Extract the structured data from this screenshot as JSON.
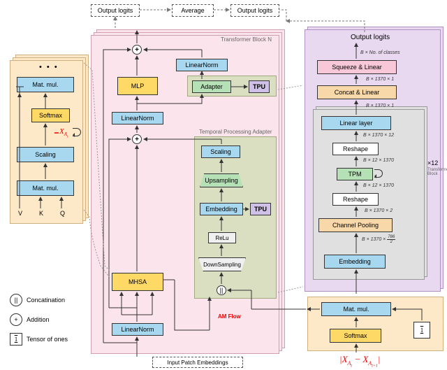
{
  "top": {
    "output_logits_1": "Output logits",
    "output_logits_2": "Output logits",
    "average": "Average"
  },
  "left_detail": {
    "matmul_top": "Mat. mul.",
    "softmax": "Softmax",
    "scaling": "Scaling",
    "matmul_bottom": "Mat. mul.",
    "x_label": "X",
    "x_sub": "A",
    "x_subsub": "t",
    "v": "V",
    "k": "K",
    "q": "Q",
    "dots": "• • •"
  },
  "legend": {
    "concat": "Concatination",
    "addition": "Addition",
    "ones": "Tensor of ones",
    "concat_sym": "||",
    "plus_sym": "+",
    "ones_sym": "1"
  },
  "transformer": {
    "title": "Transformer Block N",
    "mlp": "MLP",
    "lnorm1": "LinearNorm",
    "lnorm2": "LinearNorm",
    "lnorm3": "LinearNorm",
    "adapter": "Adapter",
    "tpu1": "TPU",
    "mhsa": "MHSA",
    "input_embed": "Input Patch Embeddings"
  },
  "tpa": {
    "title": "Temporal Processing Adapter",
    "scaling": "Scaling",
    "upsampling": "Upsampling",
    "embedding": "Embedding",
    "tpu2": "TPU",
    "relu": "ReLu",
    "downsampling": "DownSampling",
    "am_flow": "AM Flow"
  },
  "right": {
    "output_logits": "Output logits",
    "shape_out": "B × No. of classes",
    "squeeze": "Squeeze & Linear",
    "shape1": "B × 1370 × 1",
    "concat": "Concat & Linear",
    "shape2": "B × 1370 × 1",
    "linear_layer": "Linear layer",
    "shape3": "B × 1370 × 12",
    "reshape1": "Reshape",
    "shape4": "B × 12 × 1370",
    "tpm": "TPM",
    "shape5": "B × 12 × 1370",
    "reshape2": "Reshape",
    "shape6": "B × 1370 × 2",
    "chpool": "Channel Pooling",
    "shape7a": "B × 1370 ×",
    "shape7b": "786",
    "shape7c": "2",
    "embedding": "Embedding",
    "side_label": "×12",
    "side_label2": "Transformer\nBlock"
  },
  "bottom_right": {
    "matmul": "Mat. mul.",
    "softmax": "Softmax",
    "ones": "1",
    "diff": "|X_{A_t} − X_{A_{t+1}}|"
  }
}
